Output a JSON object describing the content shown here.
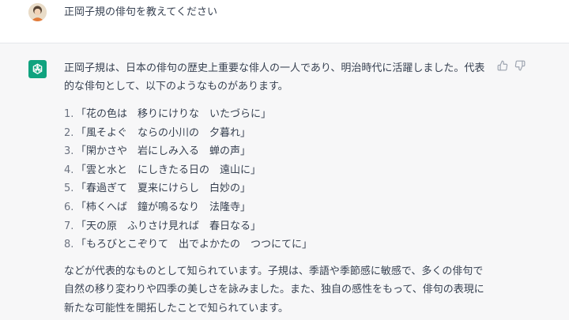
{
  "user_message": {
    "text": "正岡子規の俳句を教えてください"
  },
  "assistant_message": {
    "intro": "正岡子規は、日本の俳句の歴史上重要な俳人の一人であり、明治時代に活躍しました。代表的な俳句として、以下のようなものがあります。",
    "haiku": [
      {
        "number": "1.",
        "text": "「花の色は　移りにけりな　いたづらに」"
      },
      {
        "number": "2.",
        "text": "「風そよぐ　ならの小川の　夕暮れ」"
      },
      {
        "number": "3.",
        "text": "「閑かさや　岩にしみ入る　蝉の声」"
      },
      {
        "number": "4.",
        "text": "「雲と水と　にしきたる日の　遠山に」"
      },
      {
        "number": "5.",
        "text": "「春過ぎて　夏来にけらし　白妙の」"
      },
      {
        "number": "6.",
        "text": "「柿くへば　鐘が鳴るなり　法隆寺」"
      },
      {
        "number": "7.",
        "text": "「天の原　ふりさけ見れば　春日なる」"
      },
      {
        "number": "8.",
        "text": "「もろびとこぞりて　出でよかたの　つつにてに」"
      }
    ],
    "conclusion": "などが代表的なものとして知られています。子規は、季語や季節感に敏感で、多くの俳句で自然の移り変わりや四季の美しさを詠みました。また、独自の感性をもって、俳句の表現に新たな可能性を開拓したことで知られています。"
  },
  "icons": {
    "user_avatar": "user-avatar",
    "assistant_avatar": "openai-logo-icon",
    "thumbs_up": "thumbs-up-icon",
    "thumbs_down": "thumbs-down-icon"
  },
  "colors": {
    "assistant_bg": "#f7f7f8",
    "brand_green": "#10a37f",
    "text": "#374151"
  }
}
